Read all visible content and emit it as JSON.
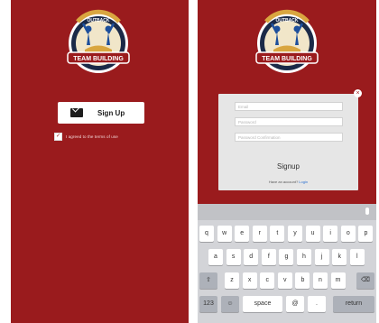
{
  "logo": {
    "top_text": "OUTBACK",
    "banner_text": "TEAM BUILDING",
    "bottom_text": "& TRAINING"
  },
  "left_screen": {
    "signup_button_label": "Sign Up",
    "agree_checked": true,
    "agree_text": "I agreed to the terms of use"
  },
  "right_screen": {
    "modal": {
      "email_placeholder": "Email",
      "password_placeholder": "Password",
      "confirm_placeholder": "Password Confirmation",
      "title": "Signup",
      "footer_prefix": "Have an account? ",
      "footer_link": "Login"
    },
    "keyboard": {
      "row1": [
        "q",
        "w",
        "e",
        "r",
        "t",
        "y",
        "u",
        "i",
        "o",
        "p"
      ],
      "row2": [
        "a",
        "s",
        "d",
        "f",
        "g",
        "h",
        "j",
        "k",
        "l"
      ],
      "row3": [
        "z",
        "x",
        "c",
        "v",
        "b",
        "n",
        "m"
      ],
      "shift": "⇧",
      "delete": "⌫",
      "numbers_key": "123",
      "emoji_key": "☺",
      "space_key": "space",
      "at_key": "@",
      "period_key": ".",
      "return_key": "return"
    }
  }
}
